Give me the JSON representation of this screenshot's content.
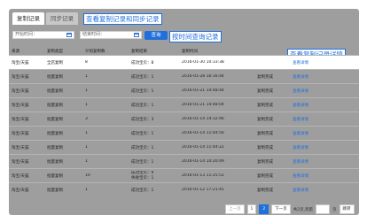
{
  "tabs": [
    {
      "label": "复制记录",
      "active": true
    },
    {
      "label": "同步记录",
      "active": false
    }
  ],
  "annotations": {
    "tabs_note": "查看复制记录和同步记录",
    "time_note": "按时间查询记录",
    "detail_note": "查看复制记录详情"
  },
  "filters": {
    "start_label": "开始时间：",
    "end_label": "结束时间：",
    "query_button": "查询"
  },
  "table": {
    "headers": [
      "来源",
      "复制类型",
      "计划复制数",
      "复制结果",
      "复制时间",
      "",
      ""
    ],
    "rows": [
      {
        "source": "淘宝/天猫",
        "type": "全店复制",
        "count": "8",
        "result": "成功宝贝：8",
        "time": "2016-01-30 10:33:38",
        "status": "",
        "action": "查看详情"
      },
      {
        "source": "淘宝/天猫",
        "type": "批量复制",
        "count": "1",
        "result": "成功宝贝：1",
        "time": "2016-01-28 16:16:44",
        "status": "复制完成",
        "action": "查看详情"
      },
      {
        "source": "淘宝/天猫",
        "type": "批量复制",
        "count": "1",
        "result": "成功宝贝：1",
        "time": "2016-01-21 14:48:44",
        "status": "复制完成",
        "action": "查看详情"
      },
      {
        "source": "淘宝/天猫",
        "type": "批量复制",
        "count": "1",
        "result": "成功宝贝：1",
        "time": "2016-01-21 14:48:04",
        "status": "复制完成",
        "action": "查看详情"
      },
      {
        "source": "淘宝/天猫",
        "type": "批量复制",
        "count": "3",
        "result": "成功宝贝：3",
        "time": "2016-01-14 14:32:46",
        "status": "复制完成",
        "action": "查看详情"
      },
      {
        "source": "淘宝/天猫",
        "type": "批量复制",
        "count": "1",
        "result": "成功宝贝：1",
        "time": "2016-01-14 11:44:56",
        "status": "复制完成",
        "action": "查看详情"
      },
      {
        "source": "淘宝/天猫",
        "type": "批量复制",
        "count": "1",
        "result": "成功宝贝：1",
        "time": "2016-01-14 11:44:22",
        "status": "复制完成",
        "action": "查看详情"
      },
      {
        "source": "淘宝/天猫",
        "type": "批量复制",
        "count": "1",
        "result": "成功宝贝：1",
        "time": "2016-01-14 10:20:49",
        "status": "复制完成",
        "action": "查看详情"
      },
      {
        "source": "淘宝/天猫",
        "type": "批量复制",
        "count": "10",
        "result": "成功宝贝：9",
        "result2": "失败宝贝：1",
        "time": "2016-01-13 11:25:51",
        "status": "复制完成",
        "action": "查看详情"
      },
      {
        "source": "淘宝/天猫",
        "type": "批量复制",
        "count": "1",
        "result": "成功宝贝：1",
        "time": "2016-01-12 17:21:45",
        "status": "复制完成",
        "action": "查看详情"
      }
    ]
  },
  "pager": {
    "prev": "上一页",
    "pages": [
      "1",
      "2"
    ],
    "current": "2",
    "next": "下一页",
    "total": "共2页,到第",
    "page_unit": "页",
    "jump": "跳转"
  },
  "colors": {
    "accent": "#1f6fdc",
    "panel": "#9e9e9e"
  }
}
